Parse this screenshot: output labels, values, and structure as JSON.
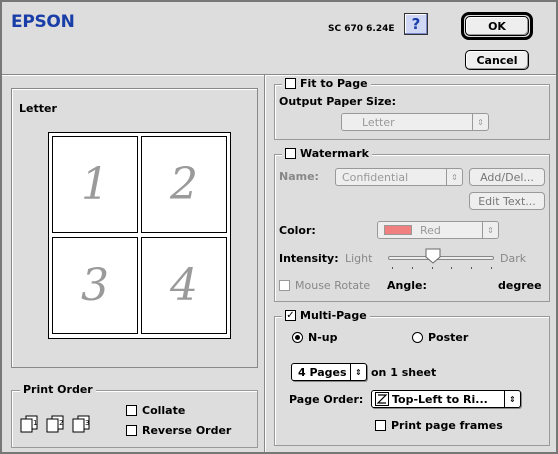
{
  "header": {
    "brand": "EPSON",
    "version": "SC 670 6.24E",
    "help_label": "?",
    "ok_label": "OK",
    "cancel_label": "Cancel",
    "brand_color": "#1a3ea8"
  },
  "preview": {
    "paper_label": "Letter",
    "pages": [
      "1",
      "2",
      "3",
      "4"
    ]
  },
  "fit_to_page": {
    "title": "Fit to Page",
    "checked": false,
    "output_label": "Output Paper Size:",
    "output_value": "Letter"
  },
  "watermark": {
    "title": "Watermark",
    "checked": false,
    "name_label": "Name:",
    "name_value": "Confidential",
    "add_del_label": "Add/Del...",
    "edit_text_label": "Edit Text...",
    "color_label": "Color:",
    "color_value": "Red",
    "swatch_color": "#f08080",
    "intensity_label": "Intensity:",
    "light_label": "Light",
    "dark_label": "Dark",
    "mouse_rotate_label": "Mouse Rotate",
    "angle_label": "Angle:",
    "angle_unit": "degree"
  },
  "multipage": {
    "title": "Multi-Page",
    "checked": true,
    "nup_label": "N-up",
    "poster_label": "Poster",
    "nup_selected": true,
    "pages_value": "4 Pages",
    "on_sheet_label": "on 1 sheet",
    "page_order_label": "Page Order:",
    "page_order_value": "Top-Left to Ri...",
    "print_frames_label": "Print page frames"
  },
  "print_order": {
    "title": "Print Order",
    "collate_label": "Collate",
    "reverse_label": "Reverse Order",
    "icon_numbers": [
      "1",
      "2",
      "3"
    ]
  }
}
